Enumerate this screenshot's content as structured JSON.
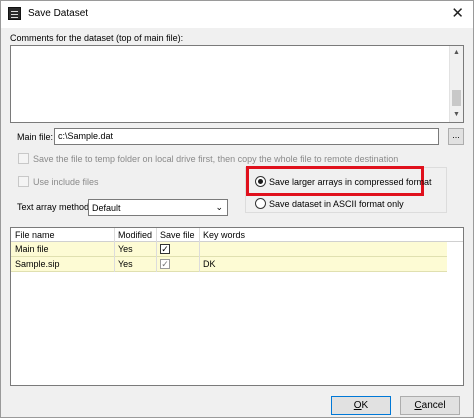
{
  "window": {
    "title": "Save Dataset"
  },
  "comments": {
    "label": "Comments for the dataset (top of main file):",
    "value": ""
  },
  "main_file": {
    "label": "Main file:",
    "value": "c:\\Sample.dat",
    "browse_label": "..."
  },
  "options": {
    "temp_folder": {
      "label": "Save the file to temp folder on local drive first, then copy the whole file to remote destination",
      "checked": false,
      "enabled": false
    },
    "include_files": {
      "label": "Use include files",
      "checked": false,
      "enabled": false
    }
  },
  "text_array_method": {
    "label": "Text array method:",
    "value": "Default"
  },
  "format": {
    "compressed": {
      "label": "Save larger arrays in compressed format",
      "selected": true
    },
    "ascii": {
      "label": "Save dataset in ASCII format only",
      "selected": false
    }
  },
  "file_table": {
    "columns": [
      "File name",
      "Modified",
      "Save file",
      "Key words"
    ],
    "rows": [
      {
        "file_name": "Main file",
        "modified": "Yes",
        "save_file": true,
        "key_words": ""
      },
      {
        "file_name": "Sample.sip",
        "modified": "Yes",
        "save_file": true,
        "key_words": "DK"
      }
    ]
  },
  "buttons": {
    "ok": {
      "label": "OK",
      "mnemonic": "O",
      "rest": "K"
    },
    "cancel": {
      "label": "Cancel",
      "mnemonic": "C",
      "rest": "ancel"
    }
  },
  "icons": {
    "app": "dataset-app-icon",
    "close": "close-icon",
    "dropdown": "chevron-down-icon",
    "check": "checkmark-icon"
  },
  "colors": {
    "highlight": "#e0101c",
    "row_bg": "#fdfbd4",
    "default_button_border": "#0078d7"
  }
}
